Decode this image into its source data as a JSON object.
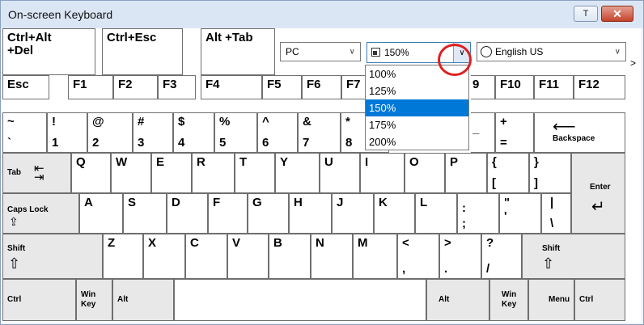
{
  "window": {
    "title": "On-screen Keyboard",
    "min_label": "T",
    "close_label": "✕"
  },
  "controls": {
    "layout_select": "PC",
    "zoom_select": "150%",
    "language_select": "English US",
    "more_label": ">",
    "zoom_options": [
      "100%",
      "125%",
      "150%",
      "175%",
      "200%"
    ],
    "selected_zoom": "150%"
  },
  "keys": {
    "ctrl_alt_del": "Ctrl+Alt\n+Del",
    "ctrl_esc": "Ctrl+Esc",
    "alt_tab": "Alt +Tab",
    "esc": "Esc",
    "f1": "F1",
    "f2": "F2",
    "f3": "F3",
    "f4": "F4",
    "f5": "F5",
    "f6": "F6",
    "f7": "F7",
    "f9": "9",
    "f10": "F10",
    "f11": "F11",
    "f12": "F12",
    "num": [
      {
        "top": "~",
        "bottom": "`"
      },
      {
        "top": "!",
        "bottom": "1"
      },
      {
        "top": "@",
        "bottom": "2"
      },
      {
        "top": "#",
        "bottom": "3"
      },
      {
        "top": "$",
        "bottom": "4"
      },
      {
        "top": "%",
        "bottom": "5"
      },
      {
        "top": "^",
        "bottom": "6"
      },
      {
        "top": "&",
        "bottom": "7"
      },
      {
        "top": "*",
        "bottom": "8"
      }
    ],
    "minus_bottom": "_",
    "plus": {
      "top": "+",
      "bottom": "="
    },
    "backspace": "Backspace",
    "tab": "Tab",
    "q": "Q",
    "w": "W",
    "e": "E",
    "r": "R",
    "t": "T",
    "y": "Y",
    "u": "U",
    "i": "I",
    "o": "O",
    "p": "P",
    "lbrace": {
      "top": "{",
      "bottom": "["
    },
    "rbrace": {
      "top": "}",
      "bottom": "]"
    },
    "enter": "Enter",
    "caps": "Caps Lock",
    "a": "A",
    "s": "S",
    "d": "D",
    "f": "F",
    "g": "G",
    "h": "H",
    "j": "J",
    "k": "K",
    "l": "L",
    "colon": {
      "top": ":",
      "bottom": ";"
    },
    "quote": {
      "top": "\"",
      "bottom": "'"
    },
    "pipe": {
      "top": "|",
      "bottom": "\\"
    },
    "shift": "Shift",
    "z": "Z",
    "x": "X",
    "c": "C",
    "v": "V",
    "b": "B",
    "n": "N",
    "m": "M",
    "lt": {
      "top": "<",
      "bottom": ","
    },
    "gt": {
      "top": ">",
      "bottom": "."
    },
    "qm": {
      "top": "?",
      "bottom": "/"
    },
    "ctrl": "Ctrl",
    "win": "Win\nKey",
    "alt": "Alt",
    "menu": "Menu"
  }
}
